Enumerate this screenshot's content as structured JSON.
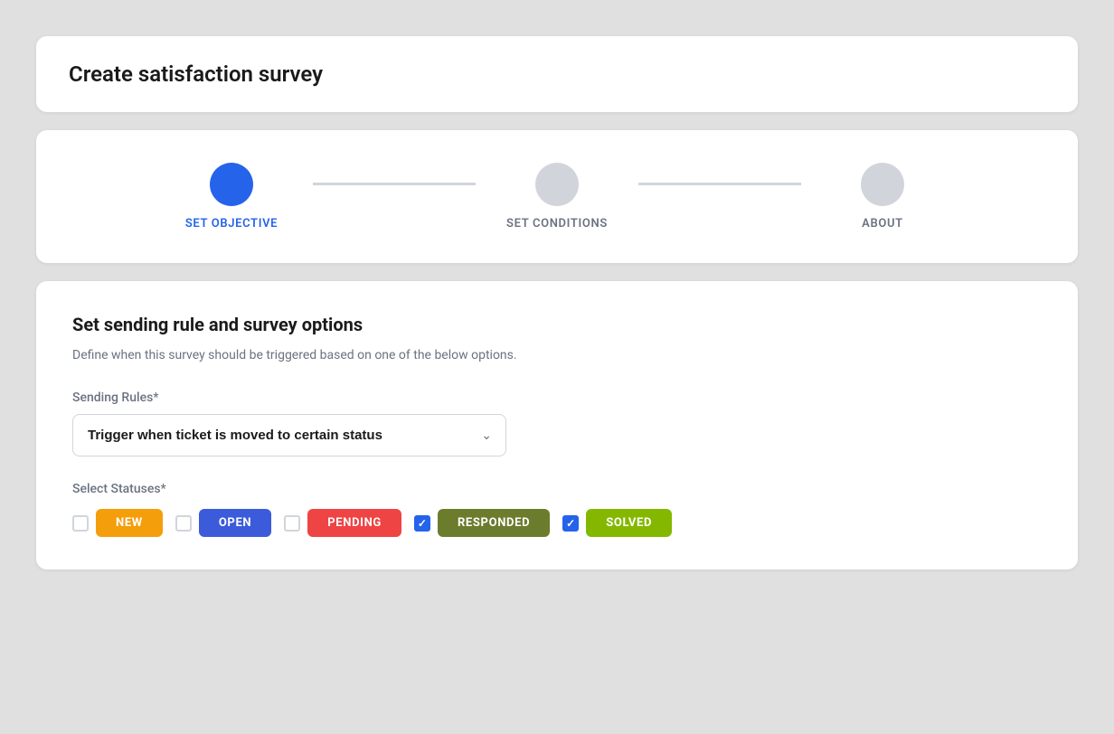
{
  "page": {
    "title": "Create satisfaction survey"
  },
  "steps": {
    "items": [
      {
        "id": "set-objective",
        "label": "SET OBJECTIVE",
        "state": "active"
      },
      {
        "id": "set-conditions",
        "label": "SET CONDITIONS",
        "state": "inactive"
      },
      {
        "id": "about",
        "label": "ABOUT",
        "state": "inactive"
      }
    ]
  },
  "form": {
    "section_title": "Set sending rule and survey options",
    "section_description": "Define when this survey should be triggered based on one of the below options.",
    "sending_rules_label": "Sending Rules*",
    "sending_rules_value": "Trigger when ticket is moved to certain status",
    "select_statuses_label": "Select Statuses*",
    "statuses": [
      {
        "id": "new",
        "label": "NEW",
        "checked": false,
        "color_class": "status-new"
      },
      {
        "id": "open",
        "label": "OPEN",
        "checked": false,
        "color_class": "status-open"
      },
      {
        "id": "pending",
        "label": "PENDING",
        "checked": false,
        "color_class": "status-pending"
      },
      {
        "id": "responded",
        "label": "RESPONDED",
        "checked": true,
        "color_class": "status-responded"
      },
      {
        "id": "solved",
        "label": "SOLVED",
        "checked": true,
        "color_class": "status-solved"
      }
    ]
  }
}
